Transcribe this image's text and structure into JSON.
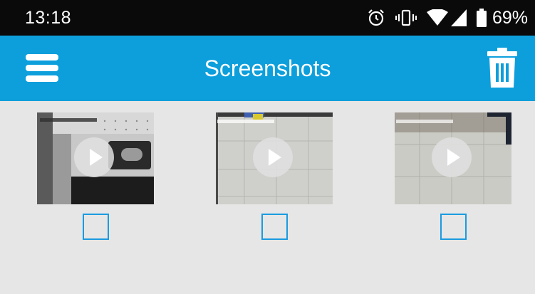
{
  "status_bar": {
    "time": "13:18",
    "battery_percent": "69%",
    "icons": [
      "alarm-icon",
      "vibrate-icon",
      "wifi-icon",
      "cellular-signal-icon",
      "battery-icon"
    ]
  },
  "app_bar": {
    "title": "Screenshots",
    "menu_icon": "hamburger-menu-icon",
    "delete_icon": "trash-icon",
    "color": "#0d9fdc"
  },
  "screenshots": [
    {
      "type": "video",
      "checked": false
    },
    {
      "type": "video",
      "checked": false
    },
    {
      "type": "video",
      "checked": false
    }
  ]
}
